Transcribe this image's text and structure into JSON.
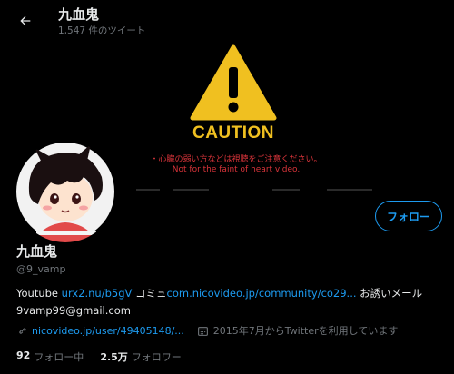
{
  "header": {
    "title": "九血鬼",
    "tweet_count": "1,547 件のツイート",
    "back_icon": "back-arrow-icon"
  },
  "banner": {
    "caution": "CAUTION",
    "warning_jp": "・心臓の弱い方などは視聴をご注意ください。",
    "warning_en": "Not for the faint of heart video."
  },
  "profile": {
    "name": "九血鬼",
    "handle": "@9_vamp",
    "follow_label": "フォロー"
  },
  "bio": {
    "youtube_label": "Youtube ",
    "youtube_link": "urx2.nu/b5gV",
    "community_label": " コミュ",
    "community_link": "com.nicovideo.jp/community/co29...",
    "invite_label": " お誘いメール",
    "email": "9vamp99@gmail.com"
  },
  "meta": {
    "website": "nicovideo.jp/user/49405148/...",
    "joined": "2015年7月からTwitterを利用しています"
  },
  "stats": {
    "following_count": "92",
    "following_label": "フォロー中",
    "followers_count": "2.5万",
    "followers_label": "フォロワー"
  },
  "colors": {
    "accent": "#1d9bf0",
    "caution_yellow": "#f0c020",
    "warning_red": "#d8343a",
    "muted": "#71767b"
  }
}
